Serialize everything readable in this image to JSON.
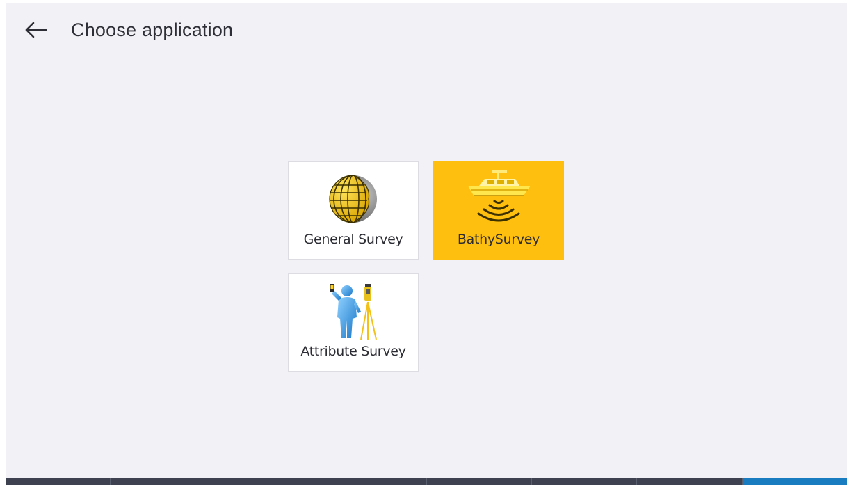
{
  "header": {
    "back_icon": "arrow-left-icon",
    "title": "Choose application"
  },
  "applications": [
    {
      "label": "General Survey",
      "icon": "globe-icon",
      "selected": false
    },
    {
      "label": "BathySurvey",
      "icon": "boat-sonar-icon",
      "selected": true
    },
    {
      "label": "Attribute Survey",
      "icon": "surveyor-tripod-icon",
      "selected": false
    }
  ],
  "bottom_bar": {
    "segments": 8,
    "active_segment": 8
  },
  "colors": {
    "background": "#f2f2f6",
    "selected_tile": "#ffbf0f",
    "bottom_bar": "#3d4150",
    "bottom_bar_active": "#1a7cc0"
  }
}
